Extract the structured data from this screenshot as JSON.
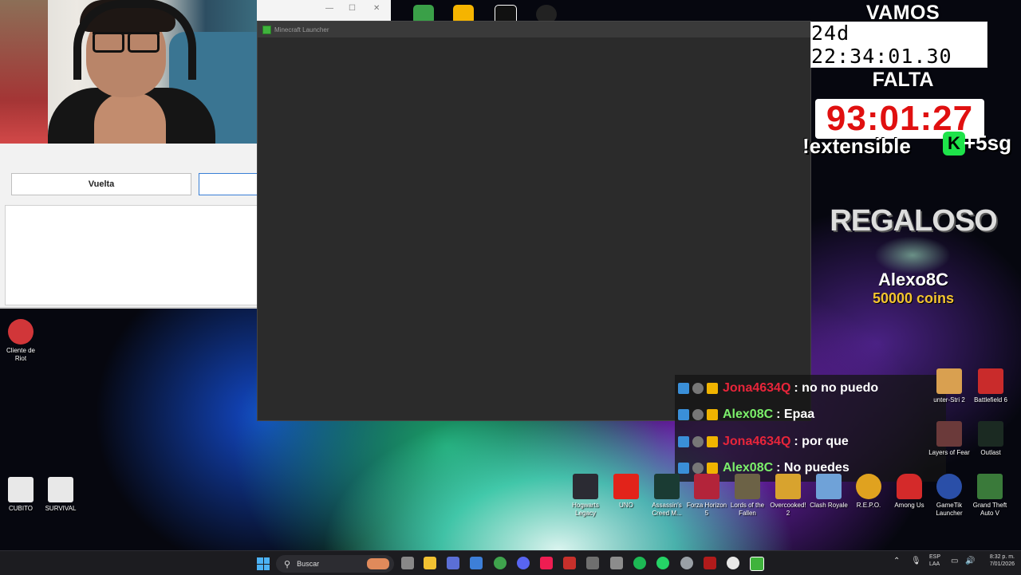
{
  "webcam": {
    "label": ""
  },
  "left_panel": {
    "vuelta_button": "Vuelta"
  },
  "launcher": {
    "title": "Minecraft Launcher"
  },
  "top_chrome": {
    "min": "—",
    "max": "☐",
    "close": "✕"
  },
  "overlay": {
    "vamos_label": "VAMOS",
    "vamos_timer": "24d 22:34:01.30",
    "falta_label": "FALTA",
    "falta_timer": "93:01:27",
    "extensible": "!extensible",
    "k_badge": "K",
    "plus_seconds": "+5sg",
    "gift_title": "REGALOSO",
    "gift_user": "Alexo8C",
    "gift_coins": "50000 coins"
  },
  "chat": {
    "messages": [
      {
        "user": "Jona4634Q",
        "color": "#e8253a",
        "text": ": no no puedo"
      },
      {
        "user": "Alex08C",
        "color": "#7cf06b",
        "text": ": Epaa"
      },
      {
        "user": "Jona4634Q",
        "color": "#e8253a",
        "text": ": por que"
      },
      {
        "user": "Alex08C",
        "color": "#7cf06b",
        "text": ": No puedes"
      }
    ]
  },
  "desktop_icons": {
    "riot": "Cliente de Riot",
    "cubito": "CUBITO",
    "survival": "SURVIVAL",
    "counter": "unter-Stri 2",
    "battlefield": "Battlefield 6",
    "layers": "Layers of Fear",
    "outlast": "Outlast",
    "hogwarts": "Hogwarts Legacy",
    "uno": "UNO",
    "assassins": "Assassin's Creed M...",
    "forza": "Forza Horizon 5",
    "lords": "Lords of the Fallen",
    "overcooked": "Overcooked! 2",
    "clash": "Clash Royale",
    "repo": "R.E.P.O.",
    "amongus": "Among Us",
    "gametik": "GameTik Launcher",
    "gta": "Grand Theft Auto V"
  },
  "taskbar": {
    "search_placeholder": "Buscar",
    "lang_line1": "ESP",
    "lang_line2": "LAA",
    "time": "8:32 p. m.",
    "date": "7/01/2026"
  },
  "colors": {
    "launcher_bg": "#2b2b2b",
    "timer_red": "#e01010",
    "coins_gold": "#f4c430",
    "k_green": "#1ee34a"
  }
}
